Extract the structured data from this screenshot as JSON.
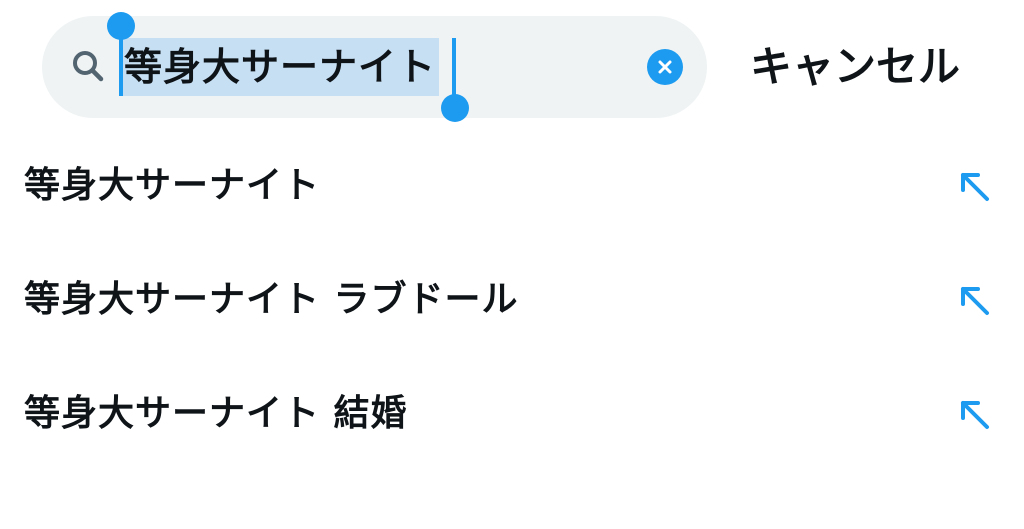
{
  "search": {
    "query": "等身大サーナイト",
    "icon": "search-icon",
    "clear_icon": "close-icon"
  },
  "cancel_label": "キャンセル",
  "suggestions": [
    {
      "label": "等身大サーナイト",
      "icon": "arrow-up-left-icon"
    },
    {
      "label": "等身大サーナイト ラブドール",
      "icon": "arrow-up-left-icon"
    },
    {
      "label": "等身大サーナイト 結婚",
      "icon": "arrow-up-left-icon"
    }
  ],
  "colors": {
    "accent": "#1d9bf0",
    "search_background": "#eff3f4",
    "selection_highlight": "#c6dff3",
    "text": "#0f1419",
    "icon_gray": "#536471"
  }
}
